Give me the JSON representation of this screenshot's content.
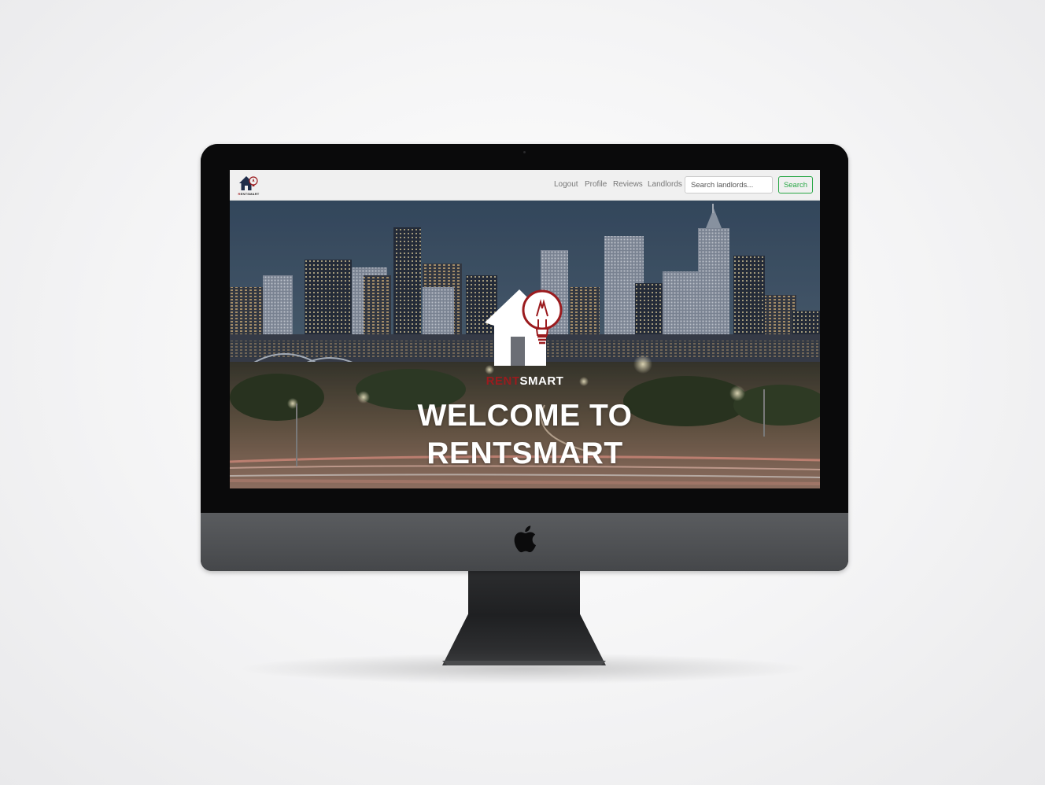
{
  "brand": {
    "rent": "RENT",
    "smart": "SMART",
    "nav_logo_text": "RENTSMART"
  },
  "nav": {
    "links": [
      "Logout",
      "Profile",
      "Reviews",
      "Landlords"
    ],
    "search_placeholder": "Search landlords...",
    "search_button": "Search"
  },
  "hero": {
    "title": "WELCOME TO RENTSMART"
  },
  "colors": {
    "brand_red": "#9b1b1e",
    "search_green": "#28a745",
    "navbar_bg": "#f0f0f0"
  },
  "icons": {
    "logo": "house-lightbulb-logo-icon",
    "device": "apple-logo-icon"
  }
}
